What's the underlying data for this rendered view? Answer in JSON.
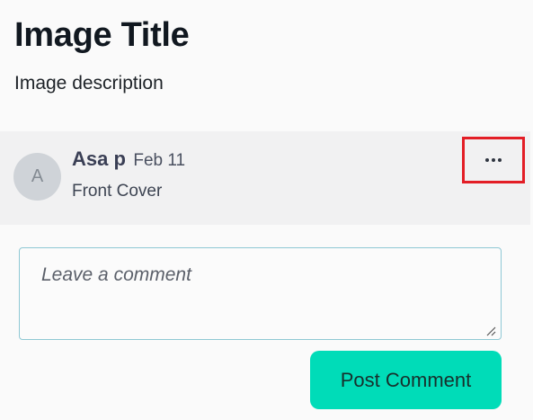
{
  "image": {
    "title": "Image Title",
    "description": "Image description"
  },
  "comments": [
    {
      "avatar_initial": "A",
      "author": "Asa p",
      "date": "Feb 11",
      "text": "Front Cover",
      "menu_icon": "more-horizontal-icon"
    }
  ],
  "comment_form": {
    "placeholder": "Leave a comment",
    "value": "",
    "submit_label": "Post Comment"
  },
  "colors": {
    "accent": "#00dcb8",
    "highlight_border": "#e31e26",
    "comment_background": "#f1f1f2"
  }
}
